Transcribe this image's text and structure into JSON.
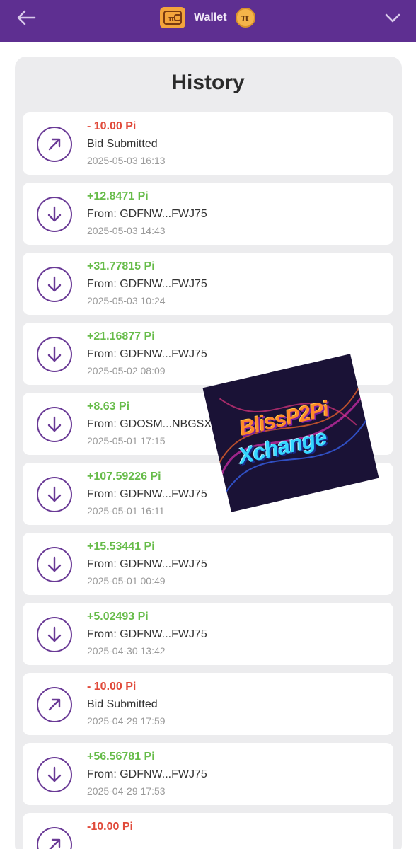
{
  "header": {
    "title": "Wallet",
    "back_icon": "arrow-left-icon",
    "wallet_icon": "wallet-icon",
    "coin_symbol": "π",
    "menu_icon": "chevron-down-icon",
    "background_color": "#5e2f91"
  },
  "history": {
    "title": "History",
    "items": [
      {
        "direction": "out",
        "amount": "- 10.00 Pi",
        "desc": "Bid Submitted",
        "date": "2025-05-03 16:13"
      },
      {
        "direction": "in",
        "amount": "+12.8471 Pi",
        "desc": "From: GDFNW...FWJ75",
        "date": "2025-05-03 14:43"
      },
      {
        "direction": "in",
        "amount": "+31.77815 Pi",
        "desc": "From: GDFNW...FWJ75",
        "date": "2025-05-03 10:24"
      },
      {
        "direction": "in",
        "amount": "+21.16877 Pi",
        "desc": "From: GDFNW...FWJ75",
        "date": "2025-05-02 08:09"
      },
      {
        "direction": "in",
        "amount": "+8.63 Pi",
        "desc": "From: GDOSM...NBGSX",
        "date": "2025-05-01 17:15"
      },
      {
        "direction": "in",
        "amount": "+107.59226 Pi",
        "desc": "From: GDFNW...FWJ75",
        "date": "2025-05-01 16:11"
      },
      {
        "direction": "in",
        "amount": "+15.53441 Pi",
        "desc": "From: GDFNW...FWJ75",
        "date": "2025-05-01 00:49"
      },
      {
        "direction": "in",
        "amount": "+5.02493 Pi",
        "desc": "From: GDFNW...FWJ75",
        "date": "2025-04-30 13:42"
      },
      {
        "direction": "out",
        "amount": "- 10.00 Pi",
        "desc": "Bid Submitted",
        "date": "2025-04-29 17:59"
      },
      {
        "direction": "in",
        "amount": "+56.56781 Pi",
        "desc": "From: GDFNW...FWJ75",
        "date": "2025-04-29 17:53"
      },
      {
        "direction": "out",
        "amount": "-10.00 Pi",
        "desc": "",
        "date": ""
      }
    ]
  },
  "overlay_logo": {
    "line1": "BlissP2Pi",
    "line2": "Xchange"
  },
  "colors": {
    "negative": "#e04a3a",
    "positive": "#67bc4a",
    "icon_ring": "#6a3a96"
  }
}
